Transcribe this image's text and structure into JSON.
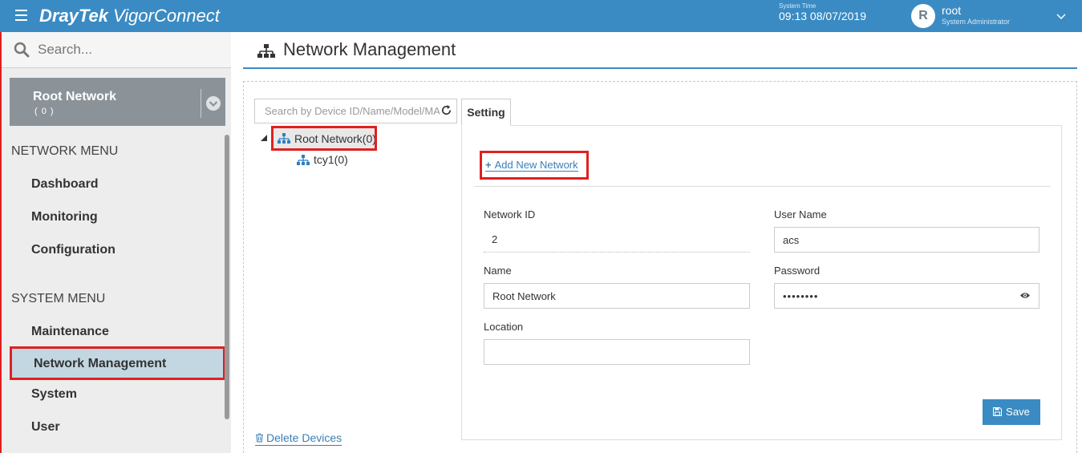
{
  "header": {
    "brand_bold": "DrayTek",
    "brand_light": "VigorConnect",
    "system_time_label": "System Time",
    "system_time": "09:13 08/07/2019",
    "avatar_letter": "R",
    "user_name": "root",
    "user_role": "System Administrator"
  },
  "sidebar": {
    "search_placeholder": "Search...",
    "selector": {
      "name": "Root Network",
      "count": "( 0 )"
    },
    "network_menu_title": "NETWORK MENU",
    "network_items": [
      "Dashboard",
      "Monitoring",
      "Configuration"
    ],
    "system_menu_title": "SYSTEM MENU",
    "system_items": [
      "Maintenance",
      "Network Management",
      "System",
      "User"
    ],
    "active_item": "Network Management"
  },
  "page": {
    "title": "Network Management"
  },
  "tree": {
    "search_placeholder": "Search by Device ID/Name/Model/MAC",
    "root_label": "Root Network(0)",
    "child_label": "tcy1(0)",
    "delete_label": "Delete Devices"
  },
  "settings": {
    "tab_label": "Setting",
    "add_new_label": "Add New Network",
    "network_id_label": "Network ID",
    "network_id_value": "2",
    "name_label": "Name",
    "name_value": "Root Network",
    "location_label": "Location",
    "location_value": "",
    "user_name_label": "User Name",
    "user_name_value": "acs",
    "password_label": "Password",
    "password_value": "••••••••",
    "save_label": "Save"
  },
  "colors": {
    "accent": "#3a8bc3",
    "highlight": "#e02020",
    "sidebar_bg": "#ededed",
    "active_bg": "#c3d7e3"
  }
}
